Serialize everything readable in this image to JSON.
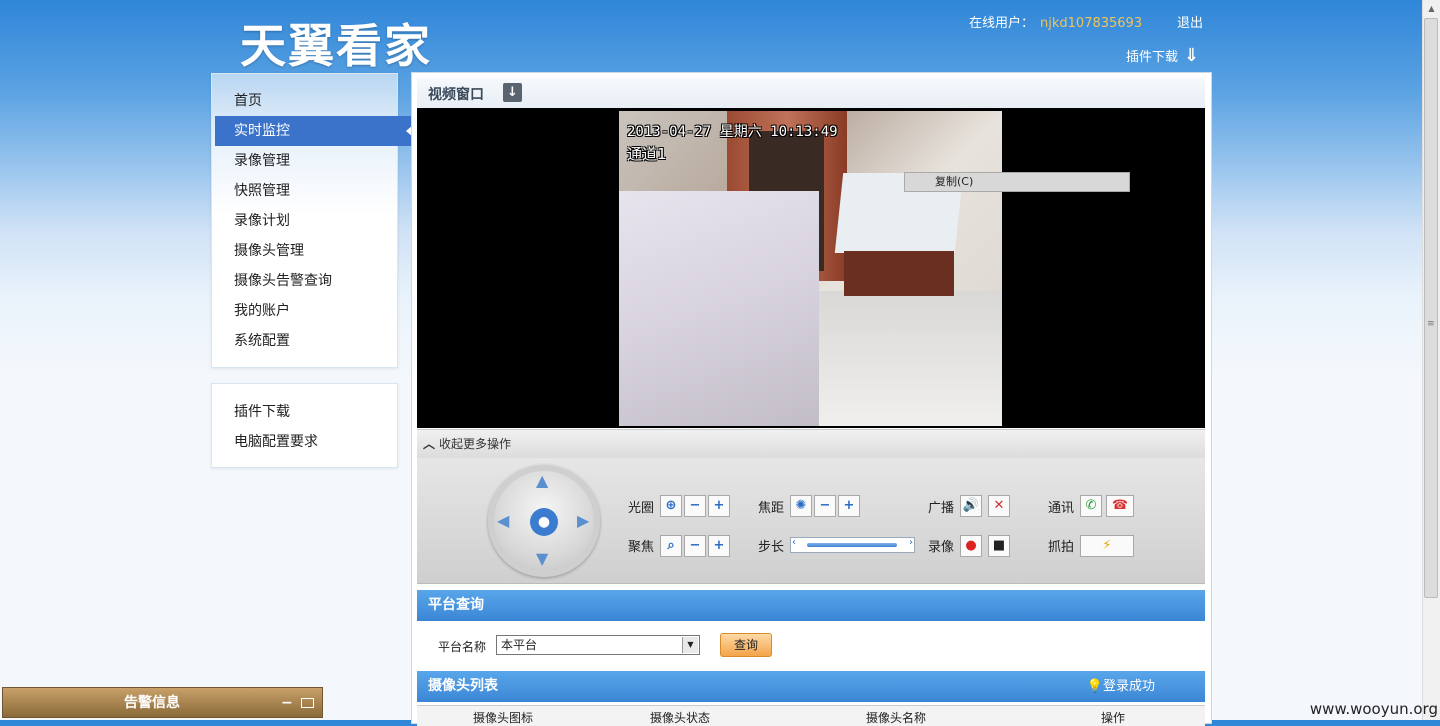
{
  "header": {
    "logo": "天翼看家",
    "online_label": "在线用户：",
    "username": "njkd107835693",
    "logout": "退出",
    "plugin_download": "插件下载"
  },
  "sidebar": {
    "items": [
      {
        "label": "首页"
      },
      {
        "label": "实时监控",
        "active": true
      },
      {
        "label": "录像管理"
      },
      {
        "label": "快照管理"
      },
      {
        "label": "录像计划"
      },
      {
        "label": "摄像头管理"
      },
      {
        "label": "摄像头告警查询"
      },
      {
        "label": "我的账户"
      },
      {
        "label": "系统配置"
      }
    ],
    "links": [
      {
        "label": "插件下载"
      },
      {
        "label": "电脑配置要求"
      }
    ]
  },
  "video": {
    "title": "视频窗口",
    "timestamp": "2013-04-27 星期六 10:13:49",
    "channel": "通道1",
    "context_menu": "复制(C)",
    "collapse": "收起更多操作"
  },
  "controls": {
    "iris": "光圈",
    "focus_distance": "焦距",
    "broadcast": "广播",
    "talk": "通讯",
    "zoom": "聚焦",
    "step": "步长",
    "record": "录像",
    "snapshot": "抓拍"
  },
  "platform": {
    "title": "平台查询",
    "name_label": "平台名称",
    "select_value": "本平台",
    "query_button": "查询"
  },
  "camera_list": {
    "title": "摄像头列表",
    "status_msg": "登录成功",
    "columns": [
      "摄像头图标",
      "摄像头状态",
      "摄像头名称",
      "操作"
    ]
  },
  "alarm": {
    "title": "告警信息"
  },
  "watermark": "www.wooyun.org"
}
